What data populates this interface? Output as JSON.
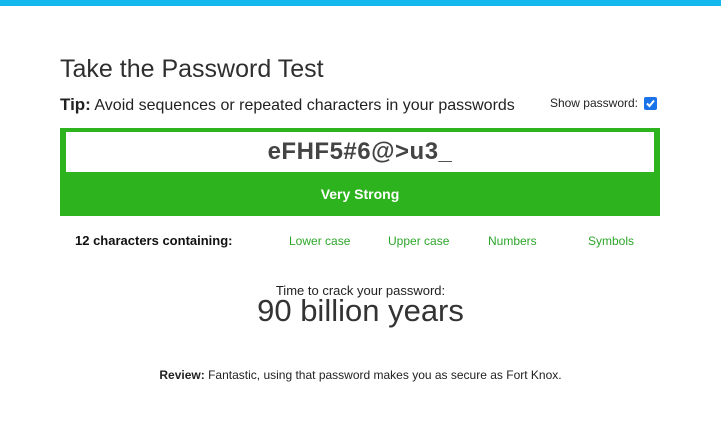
{
  "header": {
    "title": "Take the Password Test"
  },
  "tip": {
    "label": "Tip:",
    "text": "Avoid sequences or repeated characters in your passwords",
    "show_password_label": "Show password:",
    "show_password_checked": true
  },
  "meter": {
    "password": "eFHF5#6@>u3_",
    "strength": "Very Strong",
    "color": "#2db31d"
  },
  "criteria": {
    "count_label": "12 characters containing:",
    "items": [
      "Lower case",
      "Upper case",
      "Numbers",
      "Symbols"
    ],
    "met_color": "#2da52a"
  },
  "crack": {
    "label": "Time to crack your password:",
    "value": "90 billion years"
  },
  "review": {
    "label": "Review:",
    "text": "Fantastic, using that password makes you as secure as Fort Knox."
  },
  "colors": {
    "top_bar": "#13b9ee"
  }
}
